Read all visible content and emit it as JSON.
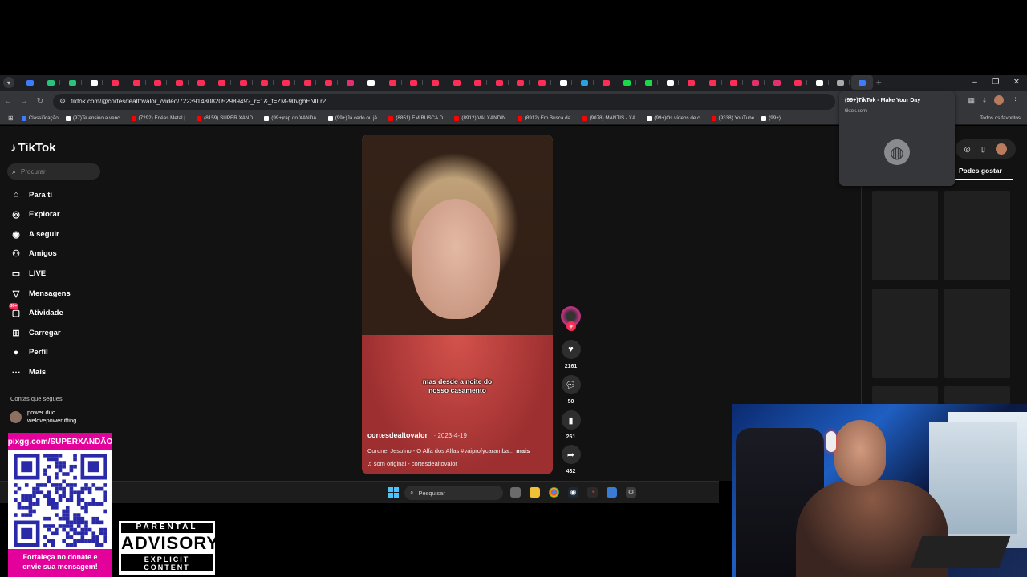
{
  "browser": {
    "url": "tiktok.com/@cortesdealtovalor_/video/7223914808205298949?_r=1&_t=ZM-90vghENILr2",
    "tab_favicon_colors": [
      "#3d7cff",
      "#29c47a",
      "#29c47a",
      "#ffffff",
      "#ff2d55",
      "#ff2d55",
      "#ff2d55",
      "#ff2d55",
      "#ff2d55",
      "#ff2d55",
      "#ff2d55",
      "#ff2d55",
      "#ff2d55",
      "#ff2d55",
      "#ff2d55",
      "#e1306c",
      "#ffffff",
      "#ff2d55",
      "#ff2d55",
      "#ff2d55",
      "#ff2d55",
      "#ff2d55",
      "#ff2d55",
      "#ff2d55",
      "#ff2d55",
      "#ffffff",
      "#2aa1e0",
      "#ff2d55",
      "#18d94c",
      "#18d94c",
      "#ffffff",
      "#ff2d55",
      "#ff2d55",
      "#ff2d55",
      "#e1306c",
      "#e1306c",
      "#ff2d55",
      "#ffffff",
      "#aaaaaa",
      "#3d7cff"
    ],
    "bookmarks": [
      {
        "label": "Classificação",
        "color": "#3d7cff"
      },
      {
        "label": "(97)Te ensino a venc...",
        "color": "#ffffff"
      },
      {
        "label": "(7292) Enéas Metal |...",
        "color": "#ff0000"
      },
      {
        "label": "(8159) SUPER XAND...",
        "color": "#ff0000"
      },
      {
        "label": "(99+)rap do XANDÃ...",
        "color": "#ffffff"
      },
      {
        "label": "(99+)Já cedo ou já...",
        "color": "#ffffff"
      },
      {
        "label": "(8851) EM BUSCA D...",
        "color": "#ff0000"
      },
      {
        "label": "(8912) VAI XANDIN...",
        "color": "#ff0000"
      },
      {
        "label": "(8912) Em Busca da...",
        "color": "#ff0000"
      },
      {
        "label": "(9078) MANTIS - XA...",
        "color": "#ff0000"
      },
      {
        "label": "(99+)Os vídeos de c...",
        "color": "#ffffff"
      },
      {
        "label": "(9338) YouTube",
        "color": "#ff0000"
      },
      {
        "label": "(99+)",
        "color": "#ffffff"
      }
    ],
    "all_bookmarks": "Todos os favoritos",
    "tab_preview": {
      "title": "(99+)TikTok - Make Your Day",
      "domain": "tiktok.com"
    }
  },
  "tiktok": {
    "logo": "TikTok",
    "search_placeholder": "Procurar",
    "nav": [
      {
        "label": "Para ti",
        "icon": "home-icon"
      },
      {
        "label": "Explorar",
        "icon": "compass-icon"
      },
      {
        "label": "A seguir",
        "icon": "following-icon"
      },
      {
        "label": "Amigos",
        "icon": "friends-icon"
      },
      {
        "label": "LIVE",
        "icon": "live-icon"
      },
      {
        "label": "Mensagens",
        "icon": "messages-icon"
      },
      {
        "label": "Atividade",
        "icon": "activity-icon",
        "badge": "99+"
      },
      {
        "label": "Carregar",
        "icon": "upload-icon"
      },
      {
        "label": "Perfil",
        "icon": "profile-icon"
      },
      {
        "label": "Mais",
        "icon": "more-icon"
      }
    ],
    "following_title": "Contas que segues",
    "following": {
      "name": "power duo",
      "handle": "welovepowerlifting"
    },
    "video": {
      "subtitle_line1": "mas desde a noite do",
      "subtitle_line2": "nosso casamento",
      "username": "cortesdealtovalor_",
      "date": "· 2023-4-19",
      "description": "Coronel Jesuíno - O Alfa dos Alfas #vaiprofycaramba...",
      "more": "mais",
      "sound": "♫ som original - cortesdealtovalor"
    },
    "actions": {
      "likes": "2161",
      "comments": "50",
      "saves": "261",
      "shares": "432"
    },
    "right_tab": "Podes gostar"
  },
  "taskbar": {
    "search_placeholder": "Pesquisar"
  },
  "overlay": {
    "donate_url": "pixgg.com/SUPERXANDÃO",
    "donate_text_1": "Fortaleça no donate e",
    "donate_text_2": "envie sua mensagem!",
    "advisory_top": "PARENTAL",
    "advisory_mid": "ADVISORY",
    "advisory_bottom": "EXPLICIT CONTENT"
  }
}
